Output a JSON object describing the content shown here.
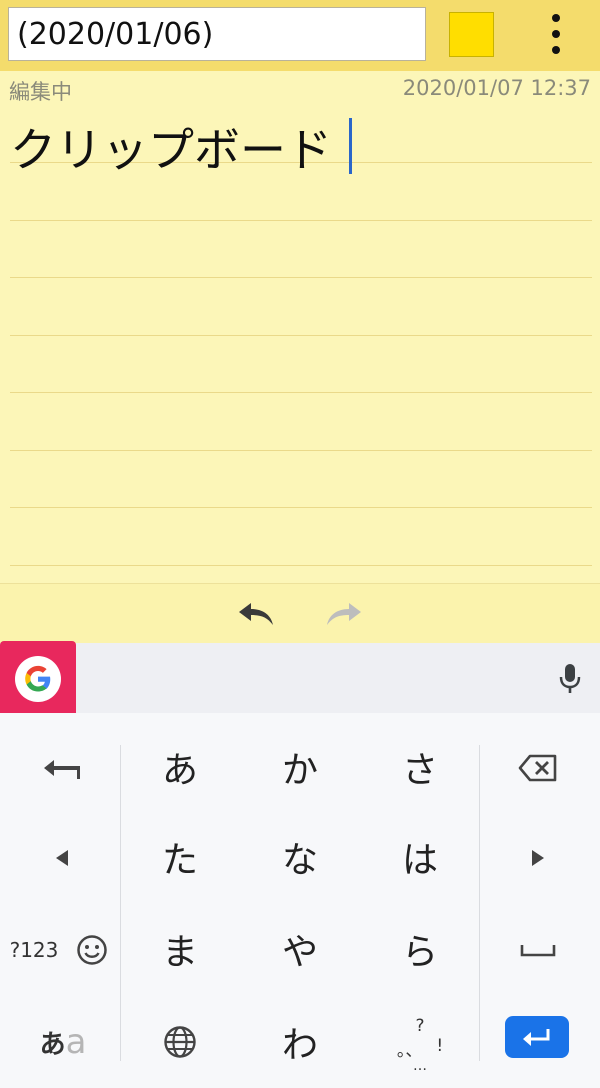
{
  "header": {
    "title_value": "(2020/01/06)",
    "swatch_color": "#ffde00",
    "menu_icon": "more-vert-icon"
  },
  "note": {
    "status": "編集中",
    "timestamp": "2020/01/07 12:37",
    "text": "クリップボード"
  },
  "edit_bar": {
    "undo_icon": "undo-icon",
    "redo_icon": "redo-icon"
  },
  "keyboard": {
    "toolbar": {
      "g_icon": "google-g-icon",
      "mic_icon": "mic-icon"
    },
    "rows": [
      [
        "あ",
        "か",
        "さ"
      ],
      [
        "た",
        "な",
        "は"
      ],
      [
        "ま",
        "や",
        "ら"
      ],
      [
        "わ"
      ]
    ],
    "left_keys": {
      "undo": "undo-arrow-icon",
      "left": "arrow-left-icon",
      "num": "?123",
      "emoji": "emoji-icon",
      "mode_main": "あ",
      "mode_alt": "a"
    },
    "right_keys": {
      "delete": "backspace-icon",
      "right": "arrow-right-icon",
      "space": "space-icon",
      "enter": "enter-icon"
    },
    "punct": {
      "q": "?",
      "small": "。、",
      "excl": "!",
      "ellipsis": "…"
    },
    "globe_icon": "globe-icon",
    "accent_color": "#1a73e8"
  }
}
